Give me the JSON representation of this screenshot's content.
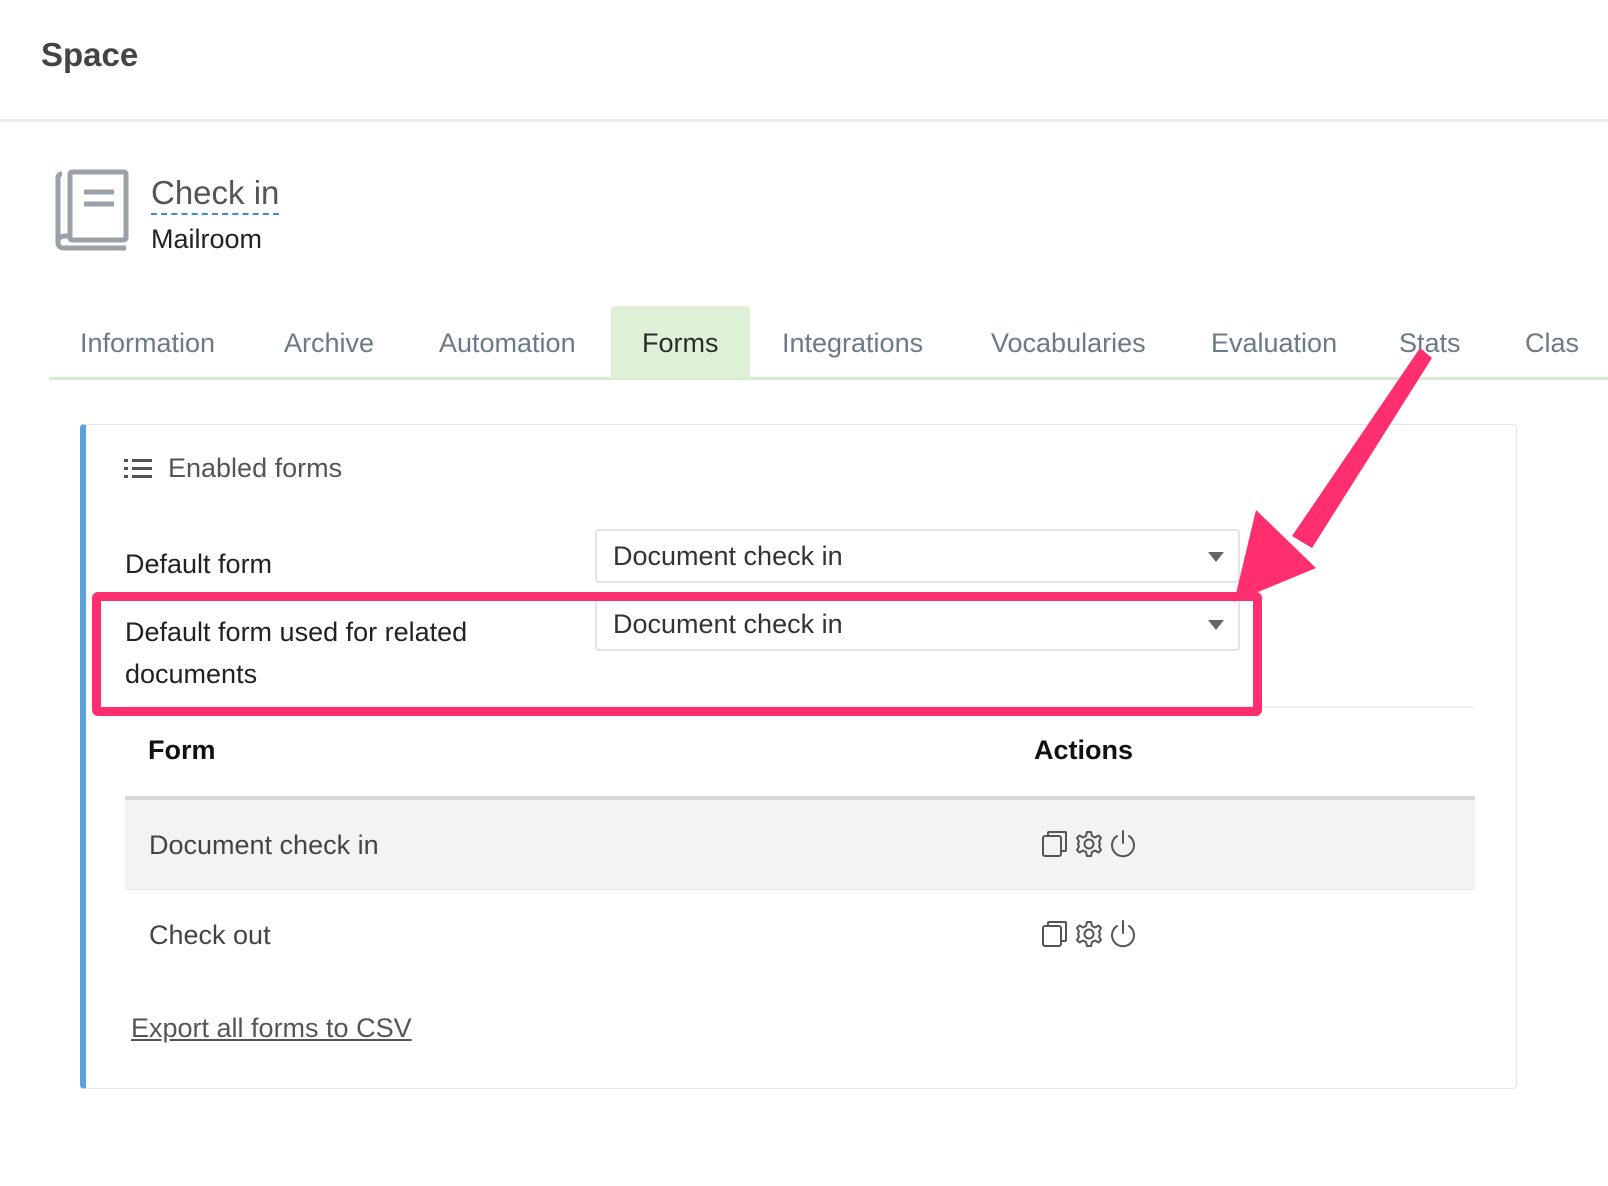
{
  "header": {
    "app_title": "Space"
  },
  "space": {
    "icon": "book-icon",
    "name": "Check in",
    "subtitle": "Mailroom"
  },
  "tabs": [
    {
      "label": "Information",
      "active": false
    },
    {
      "label": "Archive",
      "active": false
    },
    {
      "label": "Automation",
      "active": false
    },
    {
      "label": "Forms",
      "active": true
    },
    {
      "label": "Integrations",
      "active": false
    },
    {
      "label": "Vocabularies",
      "active": false
    },
    {
      "label": "Evaluation",
      "active": false
    },
    {
      "label": "Stats",
      "active": false
    },
    {
      "label": "Clas",
      "active": false
    }
  ],
  "panel": {
    "icon": "list-icon",
    "title": "Enabled forms",
    "default_form": {
      "label": "Default form",
      "value": "Document check in"
    },
    "default_related_form": {
      "label": "Default form used for related documents",
      "value": "Document check in"
    },
    "table": {
      "columns": [
        "Form",
        "Actions"
      ],
      "rows": [
        {
          "name": "Document check in",
          "actions": [
            "copy-icon",
            "gear-icon",
            "power-icon"
          ]
        },
        {
          "name": "Check out",
          "actions": [
            "copy-icon",
            "gear-icon",
            "power-icon"
          ]
        }
      ]
    },
    "export_link": "Export all forms to CSV"
  },
  "annotation": {
    "color": "#ff2f6f"
  },
  "colors": {
    "active_tab_bg": "#def1d6",
    "panel_accent": "#5ea1e0",
    "link_underline": "#3c8ad8"
  }
}
